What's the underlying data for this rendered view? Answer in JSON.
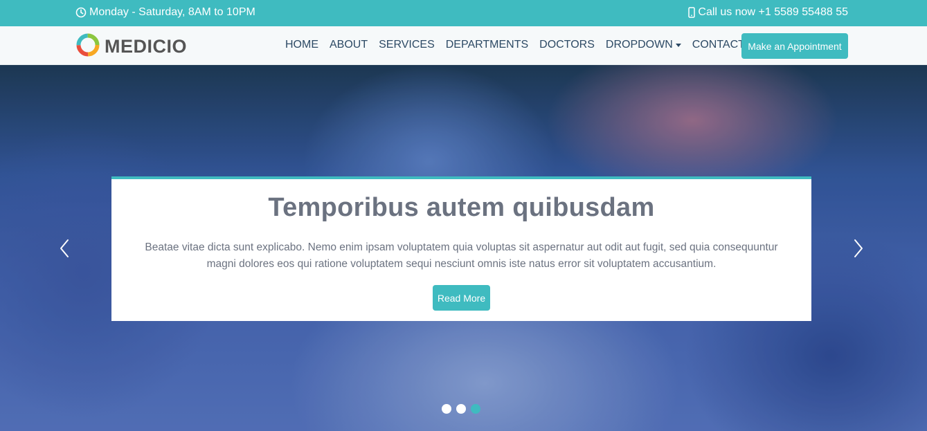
{
  "topbar": {
    "hours_icon": "clock-icon",
    "hours": "Monday - Saturday, 8AM to 10PM",
    "phone_icon": "phone-icon",
    "phone": "Call us now +1 5589 55488 55"
  },
  "header": {
    "logo_text": "MEDICIO",
    "nav": [
      {
        "label": "HOME"
      },
      {
        "label": "ABOUT"
      },
      {
        "label": "SERVICES"
      },
      {
        "label": "DEPARTMENTS"
      },
      {
        "label": "DOCTORS"
      },
      {
        "label": "DROPDOWN"
      },
      {
        "label": "CONTACT"
      }
    ],
    "appointment_label": "Make an Appointment"
  },
  "hero": {
    "title": "Temporibus autem quibusdam",
    "text": "Beatae vitae dicta sunt explicabo. Nemo enim ipsam voluptatem quia voluptas sit aspernatur aut odit aut fugit, sed quia consequuntur magni dolores eos qui ratione voluptatem sequi nesciunt omnis iste natus error sit voluptatem accusantium.",
    "button_label": "Read More",
    "slides": 3,
    "active_slide": 3
  },
  "colors": {
    "accent": "#3fbbc0",
    "nav_text": "#2c4964"
  }
}
